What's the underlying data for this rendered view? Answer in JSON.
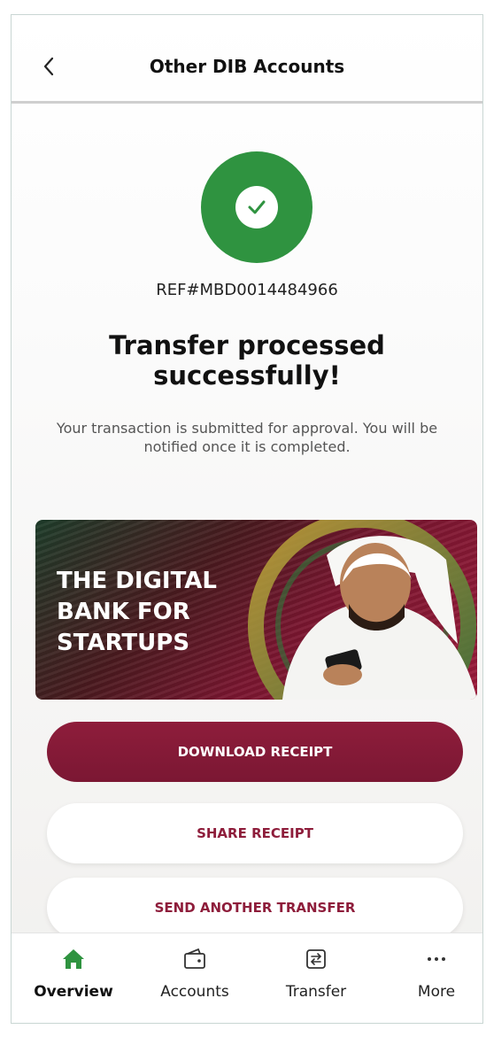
{
  "header": {
    "title": "Other DIB Accounts",
    "back_icon": "chevron-left-icon"
  },
  "result": {
    "reference": "REF#MBD0014484966",
    "title": "Transfer processed successfully!",
    "description": "Your transaction is submitted for approval. You will be notified once it is completed.",
    "status_color": "#2f9340"
  },
  "banner": {
    "text": "THE DIGITAL BANK FOR STARTUPS"
  },
  "actions": {
    "download": "DOWNLOAD RECEIPT",
    "share": "SHARE RECEIPT",
    "another": "SEND ANOTHER TRANSFER",
    "brand_color": "#8e1d3b"
  },
  "tabbar": {
    "items": [
      {
        "label": "Overview",
        "icon": "home-icon",
        "active": true
      },
      {
        "label": "Accounts",
        "icon": "wallet-icon",
        "active": false
      },
      {
        "label": "Transfer",
        "icon": "transfer-icon",
        "active": false
      },
      {
        "label": "More",
        "icon": "more-dots-icon",
        "active": false
      }
    ],
    "active_color": "#2f9340"
  }
}
